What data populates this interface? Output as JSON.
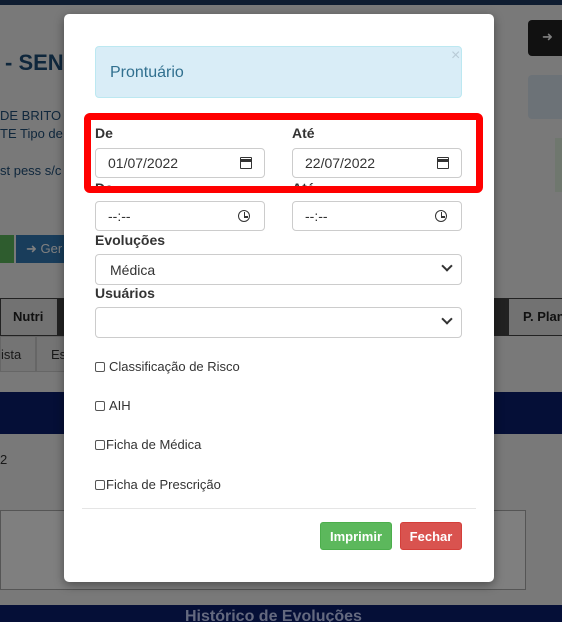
{
  "background": {
    "title_fragment": "- SEN",
    "line1": "DE BRITO",
    "line2": "TE Tipo de ",
    "line3": "st pess s/c",
    "right_button_icon": "arrow-right-icon",
    "green_btn": "",
    "blue_btn_label": "Ger",
    "tab_nutri": "Nutri",
    "tab_plan": "P. Plan",
    "tab_ista": "ista",
    "tab_es": "Es",
    "row_value": "2",
    "footer_heading": "Histórico de Evoluções"
  },
  "modal": {
    "alert_title": "Prontuário",
    "alert_close": "×",
    "date_from_label": "De",
    "date_to_label": "Até",
    "date_from_value": "01/07/2022",
    "date_to_value": "22/07/2022",
    "time_from_label": "De",
    "time_to_label": "Até",
    "time_from_value": "--:--",
    "time_to_value": "--:--",
    "evolucoes_label": "Evoluções",
    "evolucoes_value": "Médica",
    "usuarios_label": "Usuários",
    "usuarios_value": "",
    "checkboxes": [
      "Classificação de Risco",
      "AIH",
      "Ficha de Médica",
      "Ficha de Prescrição"
    ],
    "print_button": "Imprimir",
    "close_button": "Fechar"
  },
  "colors": {
    "highlight": "#ff0000",
    "alert_bg": "#d9edf7",
    "print_green": "#5cb85c",
    "close_red": "#d9534f"
  }
}
